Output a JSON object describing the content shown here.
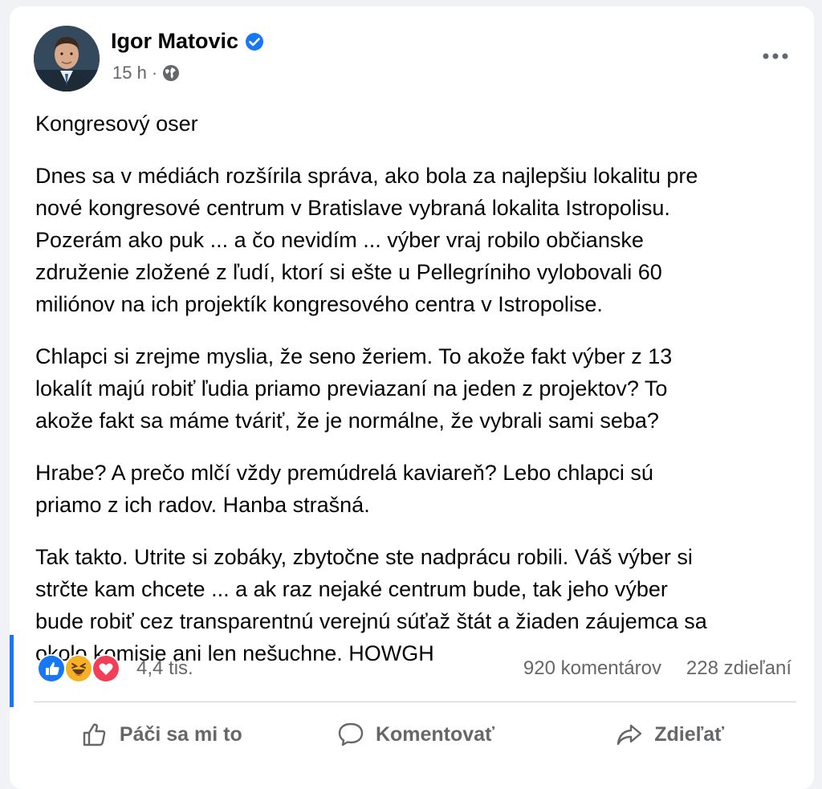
{
  "post": {
    "author": "Igor Matovic",
    "time": "15 h",
    "separator": "·",
    "title": "Kongresový oser",
    "paragraphs": [
      "Dnes sa v médiách rozšírila správa, ako bola za najlepšiu lokalitu pre\nnové kongresové centrum v Bratislave vybraná lokalita Istropolisu.\nPozerám ako puk ... a čo nevidím ... výber vraj robilo občianske\nzdruženie zložené z ľudí, ktorí si ešte u Pellegríniho vylobovali 60\nmiliónov na ich projektík kongresového centra v Istropolise.",
      "Chlapci si zrejme myslia, že seno žeriem. To akože fakt výber z 13\nlokalít majú robiť ľudia priamo previazaní na jeden z projektov? To\nakože fakt sa máme tváriť, že je normálne, že vybrali sami seba?",
      "Hrabe? A prečo mlčí vždy premúdrelá kaviareň? Lebo chlapci sú\npriamo z ich radov. Hanba strašná.",
      "Tak takto. Utrite si zobáky, zbytočne ste nadprácu robili. Váš výber si\nstrčte kam chcete ... a ak raz nejaké centrum bude, tak jeho výber\nbude robiť cez transparentnú verejnú súťaž štát a žiaden záujemca sa\nokolo komisie ani len nešuchne. HOWGH"
    ]
  },
  "stats": {
    "reactions_icons": [
      "like-icon",
      "haha-icon",
      "love-icon"
    ],
    "reactions_count": "4,4 tis.",
    "comments": "920 komentárov",
    "shares": "228 zdieľaní"
  },
  "actions": {
    "like": "Páči sa mi to",
    "comment": "Komentovať",
    "share": "Zdieľať"
  },
  "colors": {
    "accent": "#1877f2",
    "secondary_text": "#65676b",
    "love": "#f33e58",
    "haha": "#f7b125"
  }
}
